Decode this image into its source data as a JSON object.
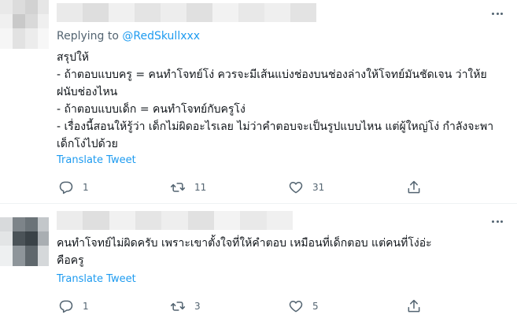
{
  "tweets": [
    {
      "replying_prefix": "Replying to ",
      "replying_handle": "@RedSkullxxx",
      "text": "สรุปให้\n- ถ้าตอบแบบครู = คนทำโจทย์โง่ ควรจะมีเส้นแบ่งช่องบนช่องล่างให้โจทย์มันชัดเจน ว่าให้ยฝนับช่องไหน\n- ถ้าตอบแบบเด็ก = คนทำโจทย์กับครูโง่\n- เรื่องนี้สอนให้รู้ว่า เด็กไม่ผิดอะไรเลย ไม่ว่าคำตอบจะเป็นรูปแบบไหน แต่ผู้ใหญ่โง่ กำลังจะพาเด็กโง่ไปด้วย",
      "translate": "Translate Tweet",
      "replies": "1",
      "retweets": "11",
      "likes": "31"
    },
    {
      "text": "คนทำโจทย์ไม่ผิดครับ เพราะเขาตั้งใจที่ให้คำตอบ เหมือนที่เด็กตอบ แต่คนที่โง่อ่ะ\nคือครู",
      "translate": "Translate Tweet",
      "replies": "1",
      "retweets": "3",
      "likes": "5"
    }
  ],
  "icons": {
    "reply": "reply-icon",
    "retweet": "retweet-icon",
    "like": "heart-icon",
    "share": "share-icon",
    "more": "more-icon"
  },
  "colors": {
    "accent": "#1d9bf0",
    "secondary_text": "#536471",
    "primary_text": "#0f1419"
  }
}
